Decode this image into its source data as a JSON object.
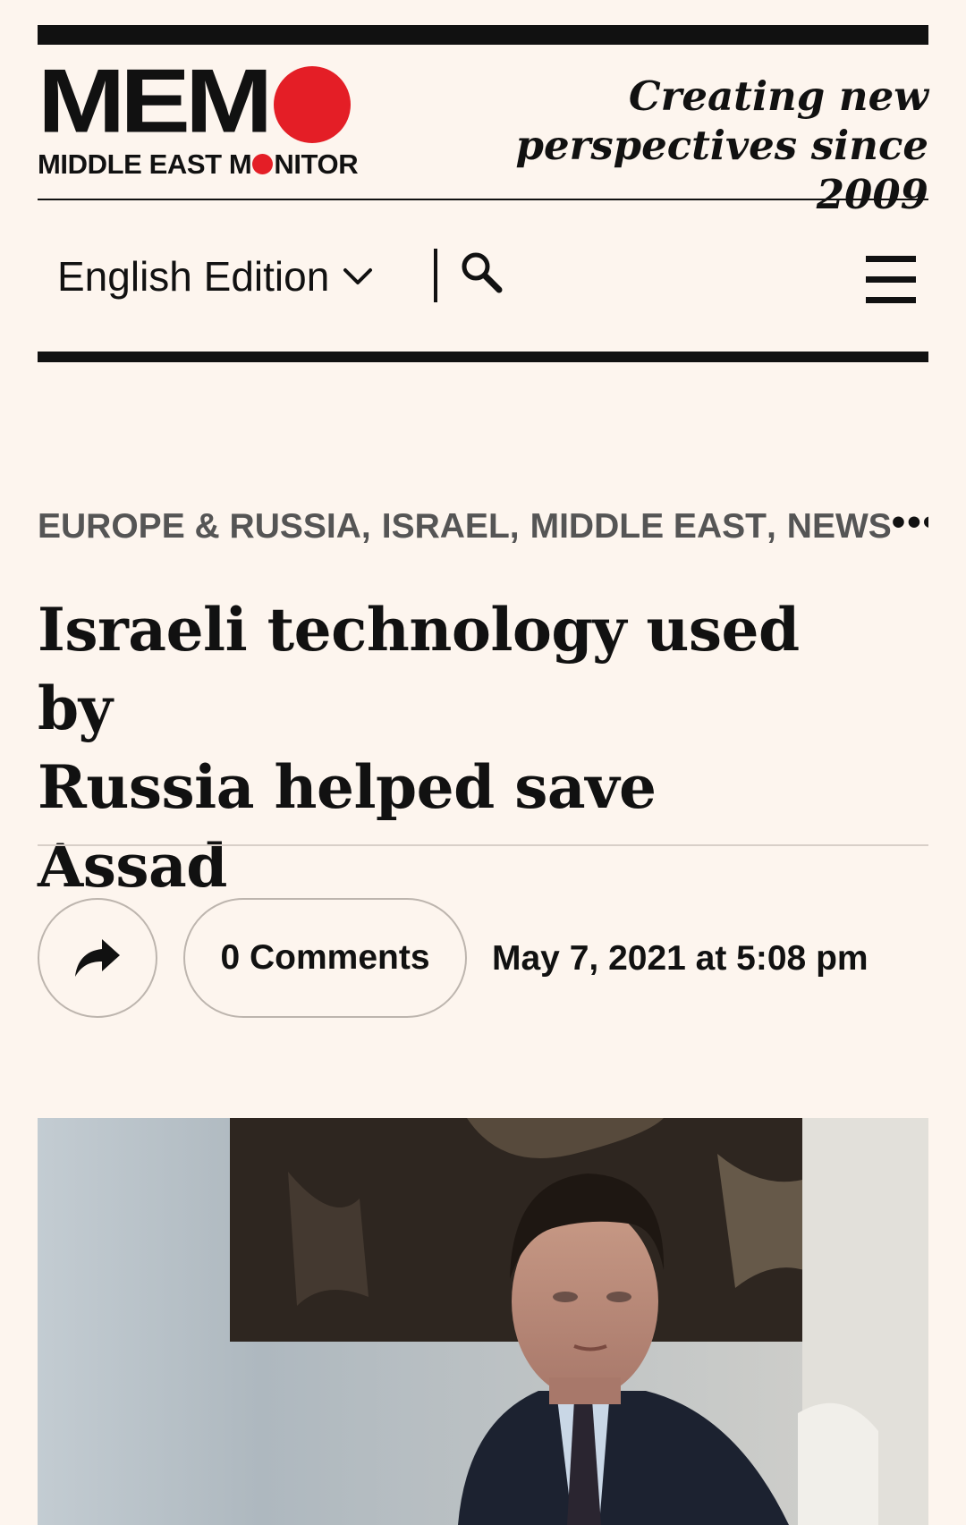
{
  "header": {
    "logo_text": "MEM",
    "logo_sub_before": "MIDDLE EAST M",
    "logo_sub_after": "NITOR",
    "tagline_line1": "Creating new",
    "tagline_line2": "perspectives since 2009"
  },
  "nav": {
    "edition_label": "English Edition",
    "icons": [
      "chevron-down-icon",
      "search-icon",
      "hamburger-menu-icon"
    ]
  },
  "article": {
    "categories": [
      "EUROPE & RUSSIA",
      "ISRAEL",
      "MIDDLE EAST",
      "NEWS"
    ],
    "categories_more": "•••",
    "headline_line1": "Israeli technology used by",
    "headline_line2": "Russia helped save Assad",
    "comments_label": "0 Comments",
    "date": "May 7, 2021 at 5:08 pm"
  },
  "colors": {
    "background": "#fdf5ee",
    "brand_red": "#e41e26",
    "text": "#111111",
    "category_text": "#555555"
  }
}
